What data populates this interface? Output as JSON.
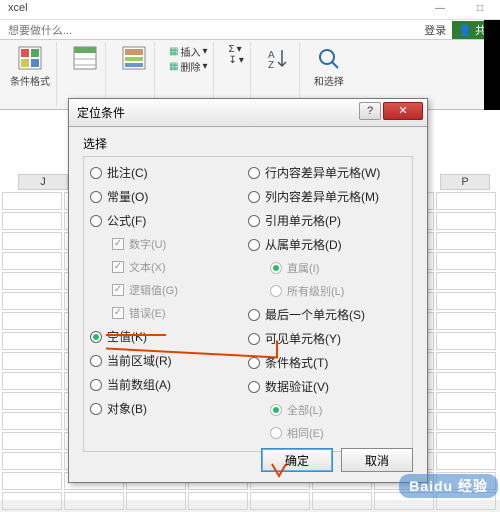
{
  "window": {
    "app_tail": "xcel",
    "min": "—",
    "max": "□",
    "close": "×"
  },
  "tellme": {
    "prompt": "想要做什么...",
    "login": "登录",
    "share": "共"
  },
  "ribbon": {
    "cond_fmt": "条件格式",
    "insert_row": "插入",
    "delete_row": "删除",
    "sum": "Σ",
    "fill": "↧",
    "sort": "排",
    "find_tail": "和选择"
  },
  "sheet": {
    "colJ": "J",
    "colP": "P"
  },
  "dialog": {
    "title": "定位条件",
    "group": "选择",
    "left": {
      "comments": "批注(C)",
      "constants": "常量(O)",
      "formulas": "公式(F)",
      "f_num": "数字(U)",
      "f_text": "文本(X)",
      "f_logic": "逻辑值(G)",
      "f_err": "错误(E)",
      "blanks": "空值(K)",
      "cur_region": "当前区域(R)",
      "cur_array": "当前数组(A)",
      "objects": "对象(B)"
    },
    "right": {
      "row_diff": "行内容差异单元格(W)",
      "col_diff": "列内容差异单元格(M)",
      "precedents": "引用单元格(P)",
      "dependents": "从属单元格(D)",
      "direct": "直属(I)",
      "all_levels": "所有级别(L)",
      "last_cell": "最后一个单元格(S)",
      "visible": "可见单元格(Y)",
      "cond_fmt": "条件格式(T)",
      "validation": "数据验证(V)",
      "v_all": "全部(L)",
      "v_same": "相同(E)"
    },
    "ok": "确定",
    "cancel": "取消"
  },
  "watermark": "Baidu 经验"
}
